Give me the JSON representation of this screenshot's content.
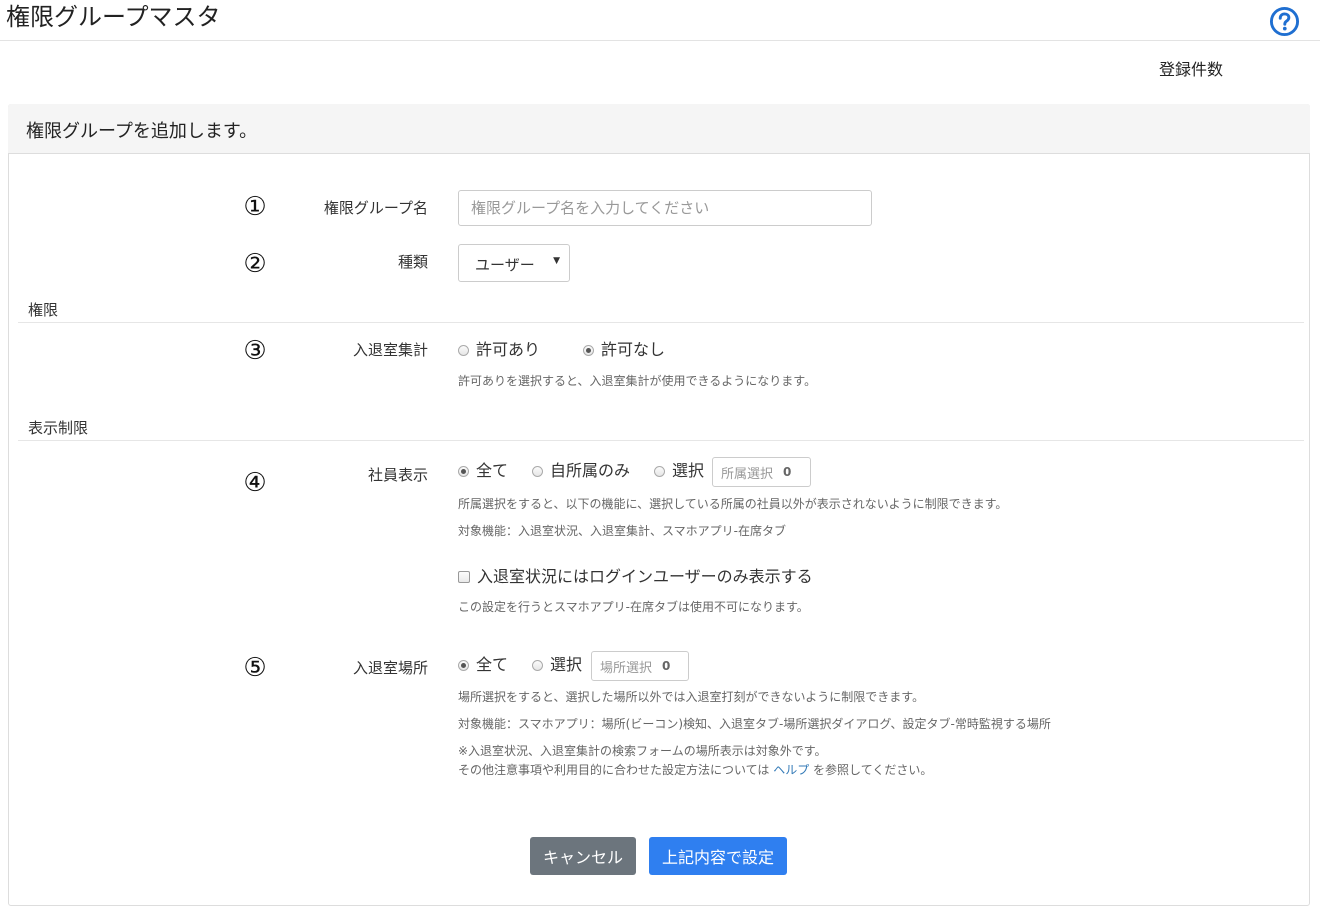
{
  "header": {
    "title": "権限グループマスタ",
    "help_icon": "question-circle-icon",
    "count_label": "登録件数"
  },
  "panel": {
    "heading": "権限グループを追加します。"
  },
  "group_name": {
    "marker": "①",
    "label": "権限グループ名",
    "placeholder": "権限グループ名を入力してください",
    "value": ""
  },
  "type": {
    "marker": "②",
    "label": "種類",
    "selected": "ユーザー"
  },
  "permissions": {
    "section_title": "権限",
    "attendance_aggregate": {
      "marker": "③",
      "label": "入退室集計",
      "options": [
        "許可あり",
        "許可なし"
      ],
      "selected": "許可なし",
      "help": "許可ありを選択すると、入退室集計が使用できるようになります。"
    }
  },
  "display_limits": {
    "section_title": "表示制限",
    "employee_display": {
      "marker": "④",
      "label": "社員表示",
      "options": [
        "全て",
        "自所属のみ",
        "選択"
      ],
      "selected": "全て",
      "picker_label": "所属選択",
      "picker_count": "0",
      "help1": "所属選択をすると、以下の機能に、選択している所属の社員以外が表示されないように制限できます。",
      "help2": "対象機能：入退室状況、入退室集計、スマホアプリ-在席タブ",
      "checkbox_label": "入退室状況にはログインユーザーのみ表示する",
      "checkbox_checked": false,
      "checkbox_help": "この設定を行うとスマホアプリ-在席タブは使用不可になります。"
    },
    "room_location": {
      "marker": "⑤",
      "label": "入退室場所",
      "options": [
        "全て",
        "選択"
      ],
      "selected": "全て",
      "picker_label": "場所選択",
      "picker_count": "0",
      "help1": "場所選択をすると、選択した場所以外では入退室打刻ができないように制限できます。",
      "help2": "対象機能：スマホアプリ：場所(ビーコン)検知、入退室タブ-場所選択ダイアログ、設定タブ-常時監視する場所",
      "help3": "※入退室状況、入退室集計の検索フォームの場所表示は対象外です。",
      "help4_before": "その他注意事項や利用目的に合わせた設定方法については ",
      "help4_link": "ヘルプ",
      "help4_after": " を参照してください。"
    }
  },
  "actions": {
    "cancel": "キャンセル",
    "submit": "上記内容で設定"
  },
  "colors": {
    "primary": "#2f7ff0",
    "secondary": "#6c757d",
    "help_icon": "#1f6fd1",
    "link": "#337ab7"
  }
}
